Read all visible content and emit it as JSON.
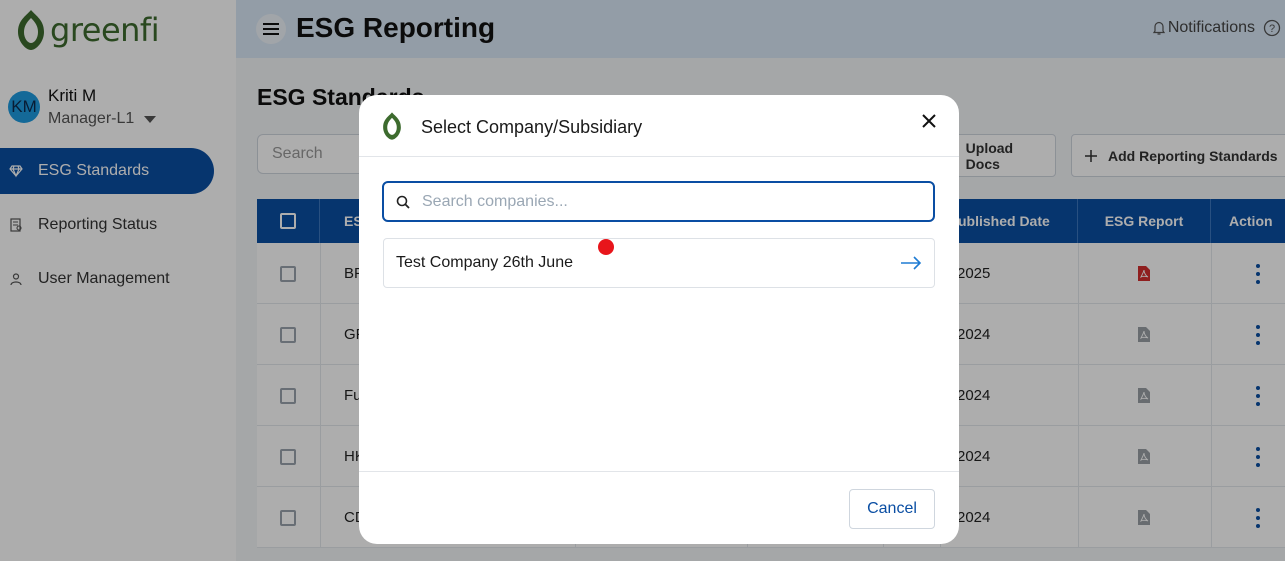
{
  "app": {
    "logo_text": "greenfi",
    "brand_color": "#3d6b2e",
    "accent_color": "#0a4ea3"
  },
  "user": {
    "initials": "KM",
    "name": "Kriti M",
    "role": "Manager-L1"
  },
  "sidebar": {
    "items": [
      {
        "label": "ESG Standards",
        "icon": "diamond-icon",
        "active": true
      },
      {
        "label": "Reporting Status",
        "icon": "report-icon",
        "active": false
      },
      {
        "label": "User Management",
        "icon": "user-icon",
        "active": false
      }
    ]
  },
  "header": {
    "title": "ESG Reporting",
    "notifications_label": "Notifications"
  },
  "main": {
    "section_title": "ESG Standards",
    "search_placeholder": "Search",
    "upload_label": "Upload Docs",
    "add_label": "Add Reporting Standards",
    "table": {
      "headers": {
        "col2": "ES",
        "published": "ublished Date",
        "report": "ESG Report",
        "action": "Action"
      },
      "rows": [
        {
          "name": "BF",
          "date": "2025",
          "report_active": true
        },
        {
          "name": "GF",
          "date": "2024",
          "report_active": false
        },
        {
          "name": "Fu",
          "date": "2024",
          "report_active": false
        },
        {
          "name": "HK",
          "date": "2024",
          "report_active": false
        },
        {
          "name": "CD",
          "date": "2024",
          "report_active": false
        }
      ]
    }
  },
  "modal": {
    "title": "Select Company/Subsidiary",
    "search_placeholder": "Search companies...",
    "companies": [
      {
        "name": "Test Company 26th June"
      }
    ],
    "cancel_label": "Cancel"
  }
}
